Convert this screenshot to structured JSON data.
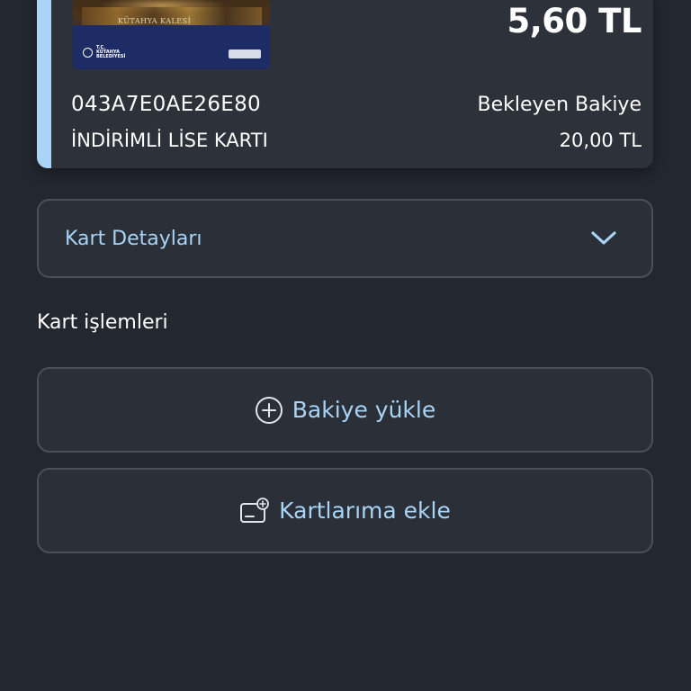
{
  "card": {
    "image_caption": "KÜTAHYA KALESİ",
    "image_logo_text": "T.C. KÜTAHYA BELEDİYESİ",
    "balance": "5,60 TL",
    "number": "043A7E0AE26E80",
    "type": "İNDİRİMLİ LİSE KARTI",
    "pending_label": "Bekleyen Bakiye",
    "pending_value": "20,00 TL",
    "accent_color": "#a9d4f5"
  },
  "details": {
    "label": "Kart Detayları",
    "icon": "chevron-down-icon"
  },
  "operations": {
    "title": "Kart işlemleri",
    "load_balance": {
      "label": "Bakiye yükle",
      "icon": "plus-circle-icon"
    },
    "add_to_cards": {
      "label": "Kartlarıma ekle",
      "icon": "add-card-icon"
    }
  },
  "colors": {
    "background": "#23272f",
    "panel": "#2c313a",
    "accent": "#a9d4f5",
    "border": "#4a505c"
  }
}
